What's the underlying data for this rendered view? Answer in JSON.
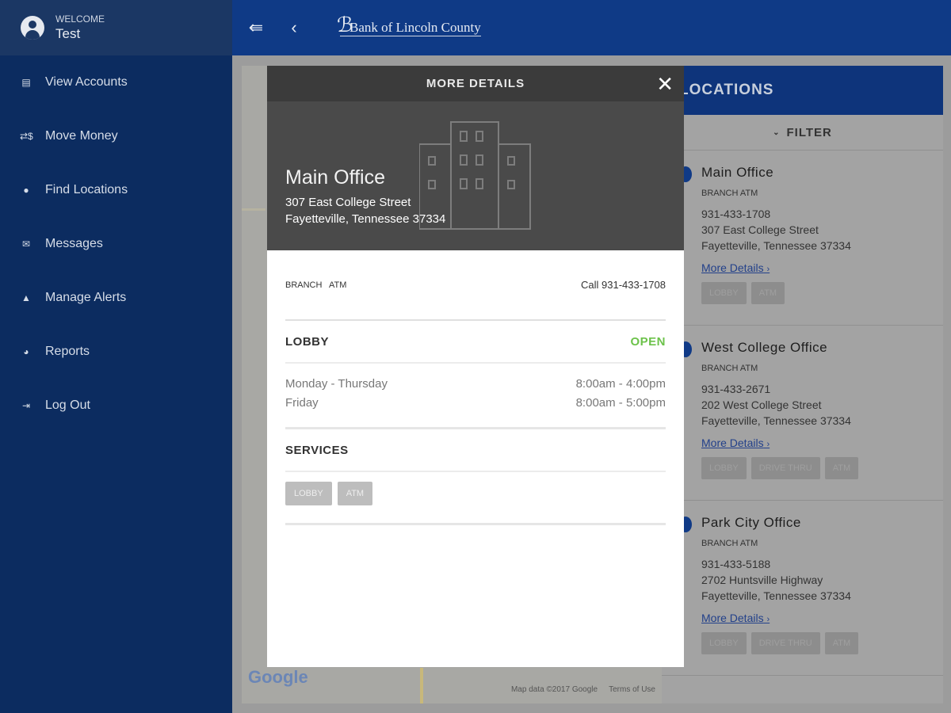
{
  "sidebar": {
    "welcome": "WELCOME",
    "user": "Test",
    "items": [
      {
        "label": "View Accounts",
        "icon": "accounts-icon",
        "glyph": "▤"
      },
      {
        "label": "Move Money",
        "icon": "transfer-icon",
        "glyph": "⇄$"
      },
      {
        "label": "Find Locations",
        "icon": "location-pin-icon",
        "glyph": "●"
      },
      {
        "label": "Messages",
        "icon": "envelope-icon",
        "glyph": "✉"
      },
      {
        "label": "Manage Alerts",
        "icon": "bell-icon",
        "glyph": "▲"
      },
      {
        "label": "Reports",
        "icon": "pie-chart-icon",
        "glyph": "◕"
      },
      {
        "label": "Log Out",
        "icon": "logout-icon",
        "glyph": "⇥"
      }
    ]
  },
  "header": {
    "logo": "Bank of Lincoln County"
  },
  "map": {
    "logo": "Google",
    "data": "Map data ©2017 Google",
    "terms": "Terms of Use"
  },
  "panel": {
    "title": "LOCATIONS",
    "filter": "FILTER",
    "more": "More Details",
    "locations": [
      {
        "name": "Main Office",
        "types": "BRANCH ATM",
        "phone": "931-433-1708",
        "street": "307 East College Street",
        "city": "Fayetteville, Tennessee 37334",
        "services": [
          "LOBBY",
          "ATM"
        ]
      },
      {
        "name": "West College Office",
        "types": "BRANCH ATM",
        "phone": "931-433-2671",
        "street": "202 West College Street",
        "city": "Fayetteville, Tennessee 37334",
        "services": [
          "LOBBY",
          "DRIVE THRU",
          "ATM"
        ]
      },
      {
        "name": "Park City Office",
        "types": "BRANCH ATM",
        "phone": "931-433-5188",
        "street": "2702 Huntsville Highway",
        "city": "Fayetteville, Tennessee 37334",
        "services": [
          "LOBBY",
          "DRIVE THRU",
          "ATM"
        ]
      }
    ]
  },
  "modal": {
    "title": "MORE DETAILS",
    "name": "Main Office",
    "street": "307 East College Street",
    "city": "Fayetteville, Tennessee 37334",
    "types": "BRANCH   ATM",
    "call_label": "Call",
    "phone": "931-433-1708",
    "lobby": "LOBBY",
    "status": "OPEN",
    "hours": [
      {
        "days": "Monday - Thursday",
        "time": "8:00am - 4:00pm"
      },
      {
        "days": "Friday",
        "time": "8:00am - 5:00pm"
      }
    ],
    "services_title": "SERVICES",
    "services": [
      "LOBBY",
      "ATM"
    ]
  },
  "colors": {
    "brand": "#0f3a86",
    "open": "#6cc24a"
  }
}
